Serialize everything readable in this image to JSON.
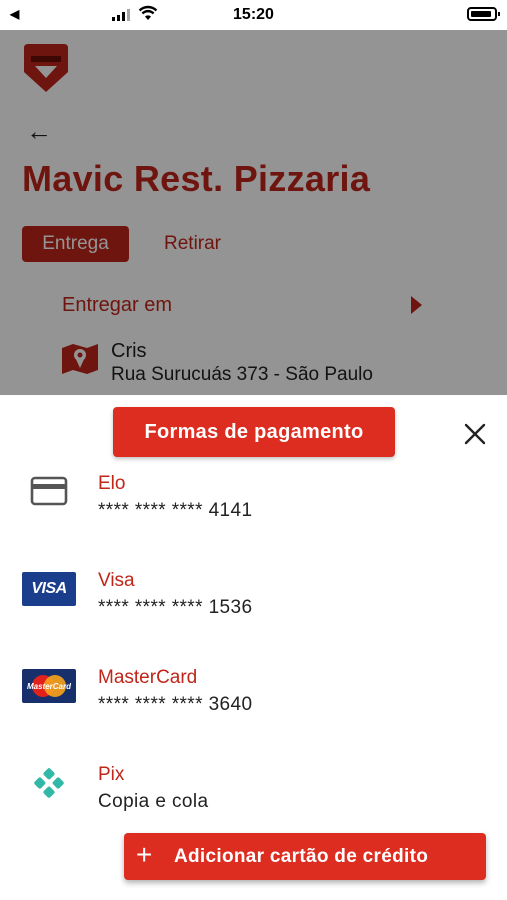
{
  "status_bar": {
    "time": "15:20",
    "icons": [
      "back-indicator-icon",
      "signal-icon",
      "wifi-icon",
      "battery-icon"
    ]
  },
  "restaurant": {
    "name": "Mavic Rest. Pizzaria",
    "tabs": [
      {
        "label": "Entrega",
        "active": true
      },
      {
        "label": "Retirar",
        "active": false
      }
    ],
    "deliver_label": "Entregar em",
    "address": {
      "name": "Cris",
      "line": "Rua Surucuás 373 - São Paulo"
    }
  },
  "payment_sheet": {
    "title": "Formas de pagamento",
    "methods": [
      {
        "name": "Elo",
        "detail": "**** **** **** 4141",
        "icon": "credit-card-icon"
      },
      {
        "name": "Visa",
        "detail": "**** **** **** 1536",
        "icon": "visa-icon",
        "icon_text": "VISA"
      },
      {
        "name": "MasterCard",
        "detail": "**** **** **** 3640",
        "icon": "mastercard-icon",
        "icon_text": "MasterCard"
      },
      {
        "name": "Pix",
        "detail": "Copia e cola",
        "icon": "pix-icon"
      }
    ],
    "add_button": {
      "icon": "+",
      "label": "Adicionar cartão de crédito"
    }
  },
  "colors": {
    "brand_red": "#c0251a",
    "button_red": "#dd2c20",
    "visa_blue": "#1a3e8c",
    "pix_teal": "#32b8a6"
  }
}
